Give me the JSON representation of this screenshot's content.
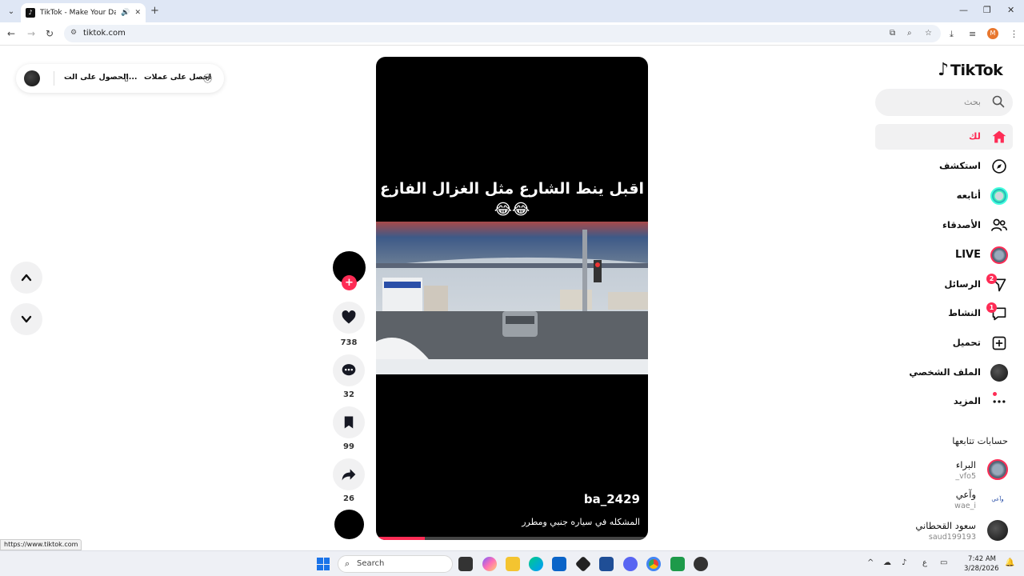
{
  "browser": {
    "tab_title": "TikTok - Make Your Day",
    "url": "tiktok.com",
    "profile_initial": "M"
  },
  "get_app": {
    "coins_label": "احصل على عملات",
    "app_label": "الحصول على الت..."
  },
  "video": {
    "overlay_text": "اقبل ينط الشارع مثل الغزال الفازع😂😂",
    "username": "ba_2429",
    "caption": "المشكله في سياره جنبي ومطرر",
    "progress": 0.18
  },
  "actions": {
    "likes": "738",
    "comments": "32",
    "saves": "99",
    "shares": "26"
  },
  "sidebar": {
    "logo": "TikTok",
    "search_placeholder": "بحث",
    "items": [
      {
        "label": "لك",
        "icon": "home-icon"
      },
      {
        "label": "استكشف",
        "icon": "compass-icon"
      },
      {
        "label": "أتابعه",
        "icon": "avatar-icon"
      },
      {
        "label": "الأصدقاء",
        "icon": "friends-icon"
      },
      {
        "label": "LIVE",
        "icon": "live-icon"
      },
      {
        "label": "الرسائل",
        "icon": "send-icon",
        "badge": "2"
      },
      {
        "label": "النشاط",
        "icon": "activity-icon",
        "badge": "1"
      },
      {
        "label": "تحميل",
        "icon": "upload-icon"
      },
      {
        "label": "الملف الشخصي",
        "icon": "profile-icon"
      },
      {
        "label": "المزيد",
        "icon": "more-icon"
      }
    ],
    "following_title": "حسابات تتابعها",
    "following": [
      {
        "name": "البراء",
        "handle": "_vfo5"
      },
      {
        "name": "وآعي",
        "handle": "wae_i"
      },
      {
        "name": "سعود القحطاني",
        "handle": "saud199193"
      }
    ]
  },
  "status_url": "https://www.tiktok.com",
  "taskbar": {
    "search_label": "Search",
    "time": "7:42 AM",
    "date": "3/28/2026",
    "lang": "ع"
  }
}
